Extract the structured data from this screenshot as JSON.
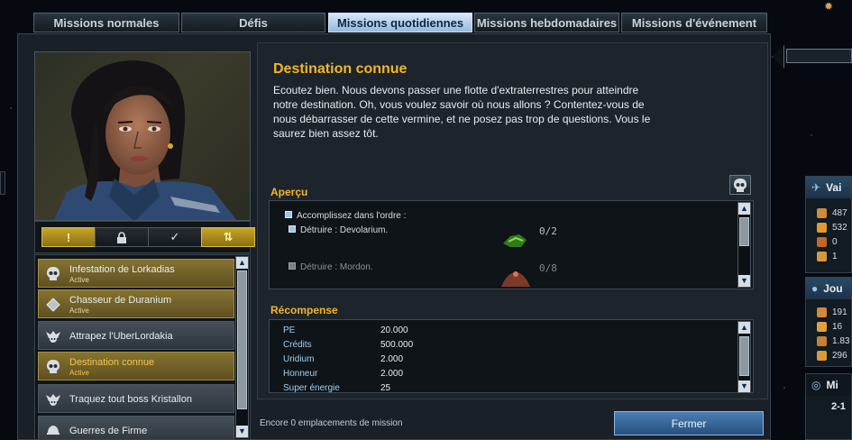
{
  "tabs": [
    {
      "label": "Missions normales",
      "active": false
    },
    {
      "label": "Défis",
      "active": false
    },
    {
      "label": "Missions quotidiennes",
      "active": true
    },
    {
      "label": "Missions hebdomadaires",
      "active": false
    },
    {
      "label": "Missions d'événement",
      "active": false
    }
  ],
  "filters": [
    {
      "label": "!",
      "icon": "exclamation-icon"
    },
    {
      "label": "",
      "icon": "lock-icon"
    },
    {
      "label": "✓",
      "icon": "check-icon"
    },
    {
      "label": "⇅",
      "icon": "sort-arrows-icon"
    }
  ],
  "missions": [
    {
      "name": "Infestation de Lorkadias",
      "status": "Active",
      "icon": "skull-icon",
      "active": true
    },
    {
      "name": "Chasseur de Duranium",
      "status": "Active",
      "icon": "diamond-icon",
      "active": true
    },
    {
      "name": "Attrapez l'UberLordakia",
      "status": "",
      "icon": "skull-wings-icon",
      "active": false
    },
    {
      "name": "Destination connue",
      "status": "Active",
      "icon": "skull-icon",
      "active": true,
      "selected": true
    },
    {
      "name": "Traquez tout boss Kristallon",
      "status": "",
      "icon": "skull-wings-icon",
      "active": false
    },
    {
      "name": "Guerres de Firme",
      "status": "",
      "icon": "helmet-icon",
      "active": false
    }
  ],
  "mission": {
    "title": "Destination connue",
    "description": "Ecoutez bien. Nous devons passer une flotte d'extraterrestres pour atteindre notre destination. Oh, vous voulez savoir où nous allons ? Contentez-vous de nous débarrasser de cette vermine, et ne posez pas trop de questions. Vous le saurez bien assez tôt."
  },
  "overview": {
    "title": "Aperçu",
    "order_label": "Accomplissez dans l'ordre :",
    "objectives": [
      {
        "label": "Détruire : Devolarium.",
        "count": "0/2",
        "enabled": true
      },
      {
        "label": "Détruire : Mordon.",
        "count": "0/8",
        "enabled": false
      }
    ]
  },
  "reward": {
    "title": "Récompense",
    "items": [
      {
        "label": "PE",
        "value": "20.000"
      },
      {
        "label": "Crédits",
        "value": "500.000"
      },
      {
        "label": "Uridium",
        "value": "2.000"
      },
      {
        "label": "Honneur",
        "value": "2.000"
      },
      {
        "label": "Super énergie",
        "value": "25"
      }
    ]
  },
  "footer": {
    "slots_text": "Encore 0 emplacements de mission",
    "close_label": "Fermer"
  },
  "hud": {
    "ship_panel": {
      "title": "Vai",
      "rows": [
        "487",
        "532",
        "0",
        "1"
      ]
    },
    "pilot_panel": {
      "title": "Jou",
      "rows": [
        "191",
        "16",
        "1.83",
        "296"
      ]
    },
    "mini_panel": {
      "title": "Mi",
      "sub": "2-1"
    }
  },
  "colors": {
    "accent_gold": "#f2b62b",
    "active_tab": "#c8dcf2",
    "active_item": "#7a6a2c",
    "close_button": "#3a6ea5"
  }
}
